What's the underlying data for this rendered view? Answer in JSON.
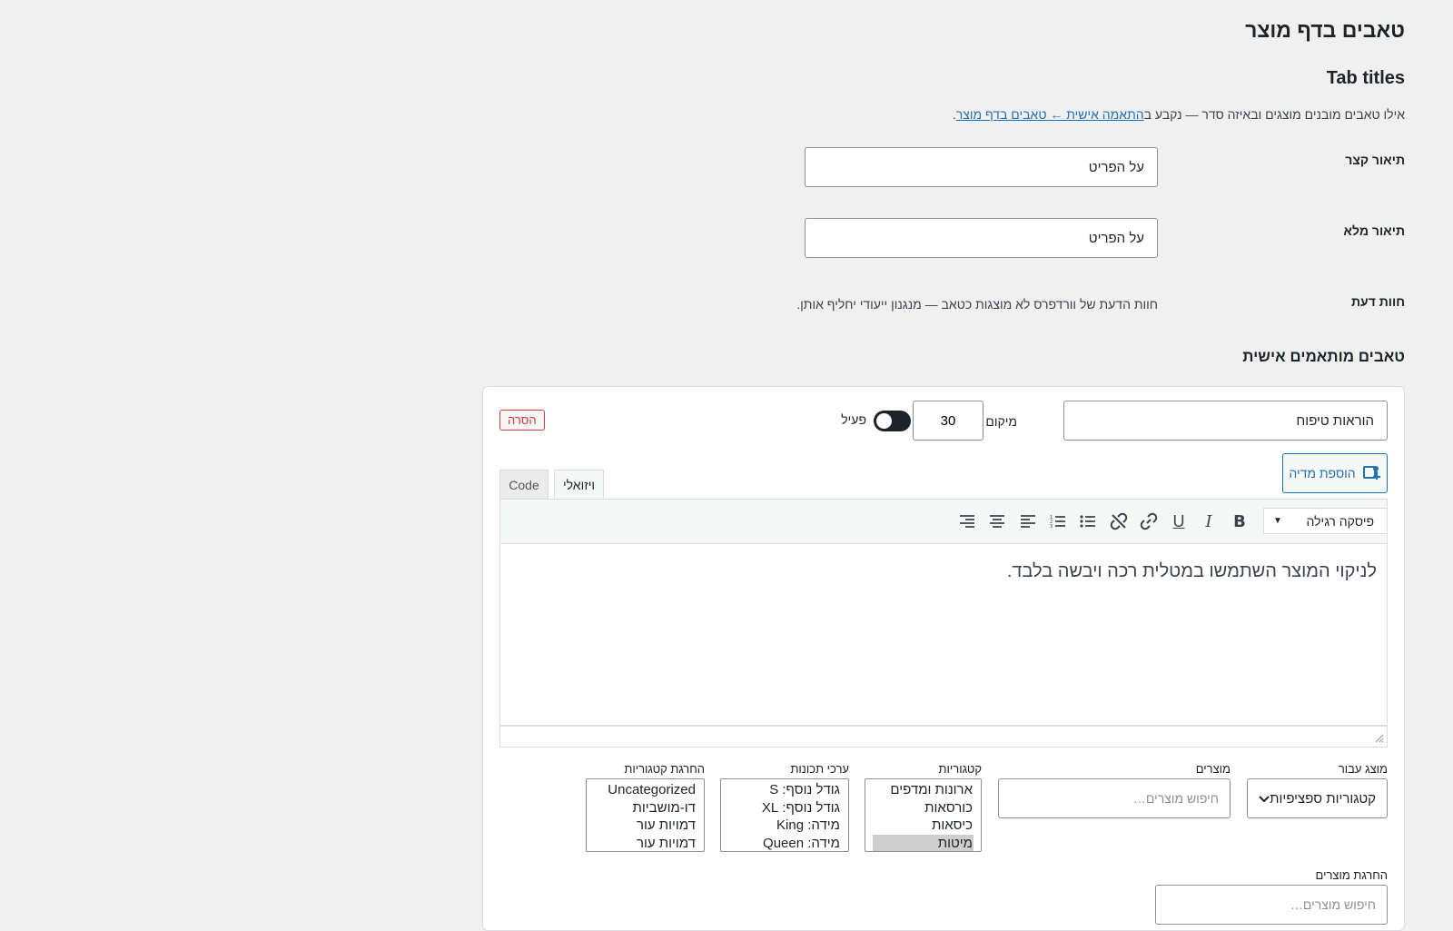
{
  "page": {
    "title": "טאבים בדף מוצר",
    "section_title": "Tab titles",
    "description_prefix": "אילו טאבים מובנים מוצגים ובאיזה סדר — נקבע ב",
    "description_link": "התאמה אישית ← טאבים בדף מוצר",
    "description_suffix": "."
  },
  "fields": {
    "short_description": {
      "label": "תיאור קצר",
      "value": "על הפריט"
    },
    "full_description": {
      "label": "תיאור מלא",
      "value": "על הפריט"
    },
    "reviews": {
      "label": "חוות דעת",
      "note": "חוות הדעת של וורדפרס לא מוצגות כטאב — מנגנון ייעודי יחליף אותן."
    }
  },
  "custom_tabs": {
    "title": "טאבים מותאמים אישית",
    "tab": {
      "name_value": "הוראות טיפוח",
      "position_label": "מיקום",
      "position_value": "30",
      "active_label": "פעיל",
      "active": true,
      "remove_label": "הסרה",
      "add_media_label": "הוספת מדיה",
      "editor_tabs": {
        "visual": "ויזואלי",
        "code": "Code"
      },
      "format_value": "פיסקה רגילה",
      "content": "לניקוי המוצר השתמשו במטלית רכה ויבשה בלבד.",
      "show_for": {
        "label": "מוצג עבור",
        "value": "קטגוריות ספציפיות"
      },
      "products": {
        "label": "מוצרים",
        "placeholder": "חיפוש מוצרים…"
      },
      "categories": {
        "label": "קטגוריות",
        "options": [
          "ארונות ומדפים",
          "כורסאות",
          "כיסאות",
          "מיטות"
        ]
      },
      "attribute_values": {
        "label": "ערכי תכונות",
        "options": [
          "גודל נוסף: S",
          "גודל נוסף: XL",
          "מידה: King",
          "מידה: Queen"
        ]
      },
      "exclude_categories": {
        "label": "החרגת קטגוריות",
        "options": [
          "Uncategorized",
          "דו-מושביות",
          "דמויות עור",
          "דמויות עור"
        ]
      },
      "exclude_products": {
        "label": "החרגת מוצרים",
        "placeholder": "חיפוש מוצרים…"
      }
    }
  },
  "icons": {
    "bold": "bold-icon",
    "italic": "italic-icon",
    "underline": "underline-icon",
    "link": "link-icon",
    "unlink": "unlink-icon",
    "bullet_list": "bullet-list-icon",
    "numbered_list": "numbered-list-icon",
    "align_left": "align-left-icon",
    "align_center": "align-center-icon",
    "align_right": "align-right-icon",
    "media": "add-media-icon",
    "chevron": "chevron-down-icon"
  },
  "colors": {
    "accent": "#2271b1",
    "danger": "#d63638",
    "toggle_on": "#1d2327"
  }
}
